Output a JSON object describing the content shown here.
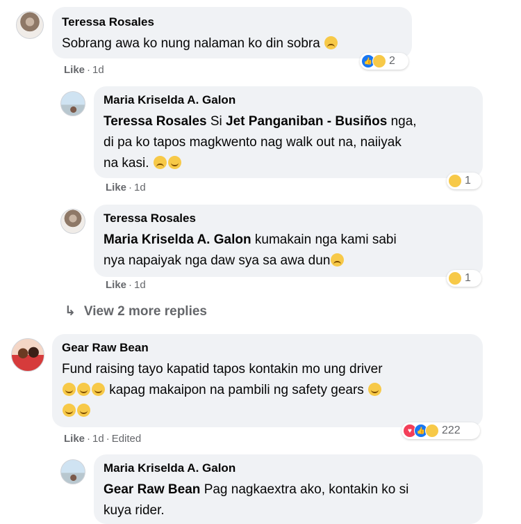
{
  "comments": [
    {
      "author": "Teressa Rosales",
      "text": "Sobrang awa ko nung nalaman ko din sobra",
      "like": "Like",
      "time": "1d",
      "reaction_count": "2"
    },
    {
      "author": "Maria Kriselda A. Galon",
      "mention": "Teressa Rosales",
      "mention2": "Jet Panganiban - Busiños",
      "text_pre": "Si",
      "text_mid": "nga,",
      "text_line2": "di pa ko tapos magkwento nag walk out na, naiiyak",
      "text_line3": "na kasi.",
      "like": "Like",
      "time": "1d",
      "reaction_count": "1"
    },
    {
      "author": "Teressa Rosales",
      "mention": "Maria Kriselda A. Galon",
      "text_line1": "kumakain nga kami sabi",
      "text_line2": "nya napaiyak nga daw sya sa awa dun",
      "like": "Like",
      "time": "1d",
      "reaction_count": "1"
    },
    {
      "author": "Gear Raw Bean",
      "text_line1": "Fund raising tayo kapatid tapos kontakin mo ung driver",
      "text_line2": "kapag makaipon na pambili ng safety gears",
      "like": "Like",
      "time": "1d",
      "edited": "Edited",
      "reaction_count": "222"
    },
    {
      "author": "Maria Kriselda A. Galon",
      "mention": "Gear Raw Bean",
      "text_line1": "Pag nagkaextra ako, kontakin ko si",
      "text_line2": "kuya rider."
    }
  ],
  "view_more": "View 2 more replies",
  "sep": "·"
}
